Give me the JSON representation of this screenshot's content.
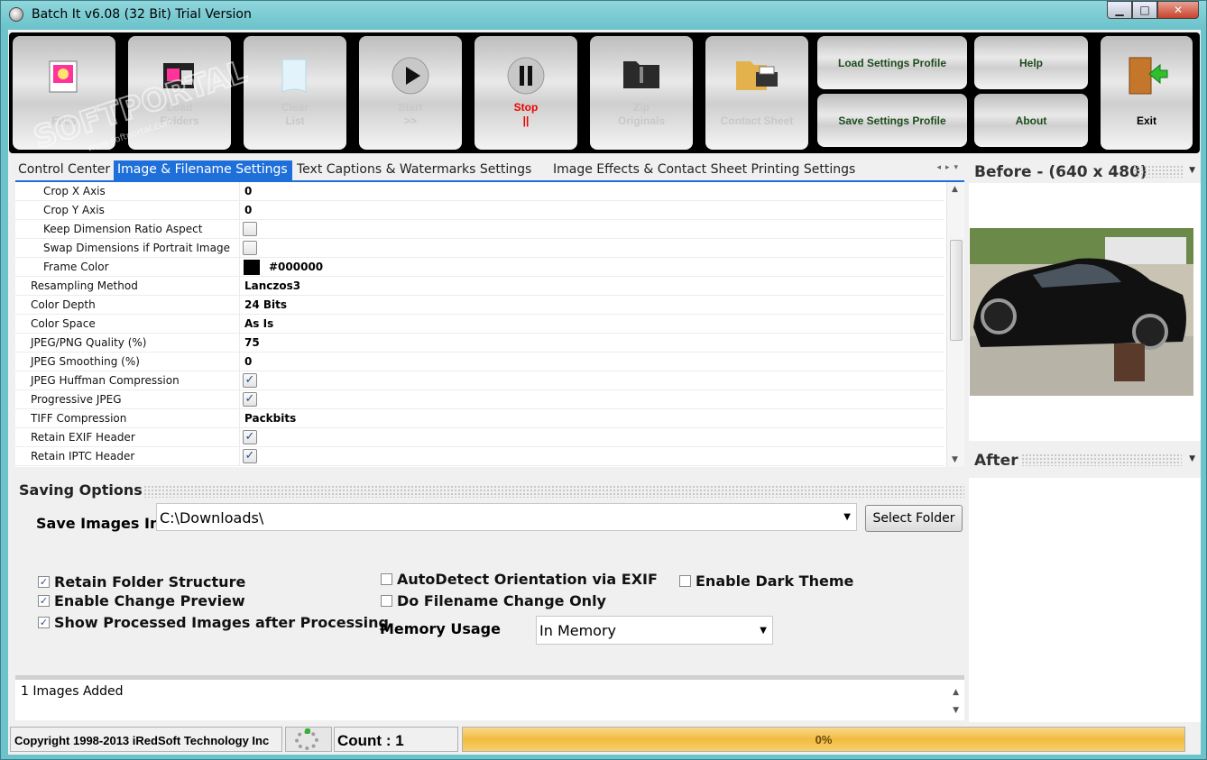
{
  "window": {
    "title": "Batch It v6.08 (32 Bit) Trial Version",
    "minimize_glyph": "▁",
    "maximize_glyph": "□",
    "close_glyph": "✕"
  },
  "toolbar": {
    "files": "Files",
    "load_folders": "Load\nFolders",
    "clear_list": "Clear\nList",
    "start": "Start\n>>",
    "stop": "Stop\n||",
    "zip_originals": "Zip\nOriginals",
    "contact_sheet": "Contact Sheet",
    "load_settings_profile": "Load Settings Profile",
    "save_settings_profile": "Save Settings Profile",
    "help": "Help",
    "about": "About",
    "exit": "Exit"
  },
  "tabs": [
    {
      "label": "Control Center",
      "active": false
    },
    {
      "label": "Image & Filename Settings",
      "active": true
    },
    {
      "label": "Text Captions & Watermarks Settings",
      "active": false
    },
    {
      "label": "Image Effects & Contact Sheet Printing Settings",
      "active": false
    }
  ],
  "properties": [
    {
      "label": "Crop X Axis",
      "value": "0",
      "type": "text",
      "indent": true
    },
    {
      "label": "Crop Y Axis",
      "value": "0",
      "type": "text",
      "indent": true
    },
    {
      "label": "Keep Dimension Ratio Aspect",
      "value": false,
      "type": "checkbox",
      "indent": true
    },
    {
      "label": "Swap Dimensions if Portrait Image",
      "value": false,
      "type": "checkbox",
      "indent": true
    },
    {
      "label": "Frame Color",
      "value": "#000000",
      "type": "color",
      "indent": true
    },
    {
      "label": "Resampling Method",
      "value": "Lanczos3",
      "type": "text",
      "indent": false
    },
    {
      "label": "Color Depth",
      "value": "24 Bits",
      "type": "text",
      "indent": false
    },
    {
      "label": "Color Space",
      "value": "As Is",
      "type": "text",
      "indent": false
    },
    {
      "label": "JPEG/PNG Quality (%)",
      "value": "75",
      "type": "text",
      "indent": false
    },
    {
      "label": "JPEG Smoothing (%)",
      "value": "0",
      "type": "text",
      "indent": false
    },
    {
      "label": "JPEG Huffman Compression",
      "value": true,
      "type": "checkbox",
      "indent": false
    },
    {
      "label": "Progressive JPEG",
      "value": true,
      "type": "checkbox",
      "indent": false
    },
    {
      "label": "TIFF Compression",
      "value": "Packbits",
      "type": "text",
      "indent": false
    },
    {
      "label": "Retain EXIF Header",
      "value": true,
      "type": "checkbox",
      "indent": false
    },
    {
      "label": "Retain IPTC Header",
      "value": true,
      "type": "checkbox",
      "indent": false
    }
  ],
  "saving": {
    "title": "Saving Options",
    "save_images_in_label": "Save Images In",
    "save_path": "C:\\Downloads\\",
    "select_folder": "Select Folder",
    "options": [
      {
        "label": "Retain Folder Structure",
        "checked": true
      },
      {
        "label": "Enable Change Preview",
        "checked": true
      },
      {
        "label": "Show Processed Images after Processing",
        "checked": true
      },
      {
        "label": "AutoDetect Orientation via EXIF",
        "checked": false
      },
      {
        "label": "Do Filename Change Only",
        "checked": false
      },
      {
        "label": "Enable Dark Theme",
        "checked": false
      }
    ],
    "memory_usage_label": "Memory Usage",
    "memory_usage_value": "In Memory"
  },
  "log": {
    "text": "1 Images Added"
  },
  "status": {
    "copyright": "Copyright 1998-2013 iRedSoft Technology Inc",
    "count": "Count : 1",
    "progress_text": "0%",
    "progress_fraction": 0
  },
  "preview": {
    "before_title": "Before - (640 x 480)",
    "after_title": "After"
  },
  "watermark": {
    "text": "SOFTPORTAL",
    "url": "www.softportal.com"
  },
  "colors": {
    "accent": "#1e6fd9",
    "stop": "#e00000",
    "progress": "#f2bb41"
  },
  "icons": [
    "files-icon",
    "load-folders-icon",
    "clear-list-icon",
    "start-icon",
    "stop-icon",
    "zip-folder-icon",
    "contact-sheet-icon",
    "exit-door-icon"
  ]
}
